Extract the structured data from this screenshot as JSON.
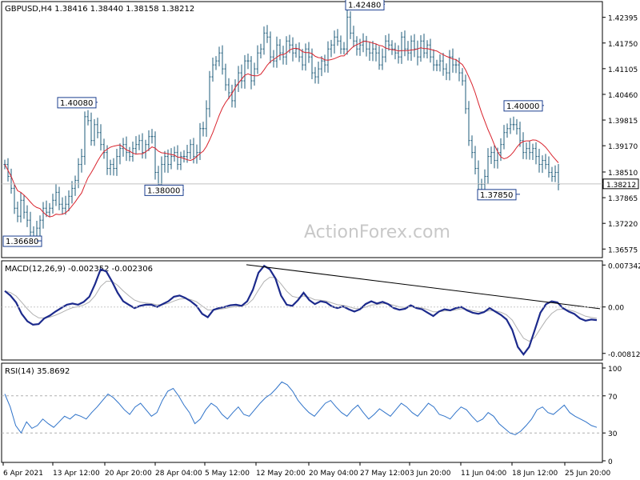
{
  "chart_data": [
    {
      "type": "candlestick",
      "panel": "price",
      "title": "GBPUSD,H4  1.38416 1.38440 1.38158 1.38212",
      "watermark": "ActionForex.com",
      "y_ticks": [
        "1.42395",
        "1.41750",
        "1.41105",
        "1.40460",
        "1.39815",
        "1.39170",
        "1.38510",
        "1.37865",
        "1.37220",
        "1.36575"
      ],
      "y_tick_values": [
        1.42395,
        1.4175,
        1.41105,
        1.4046,
        1.39815,
        1.3917,
        1.3851,
        1.37865,
        1.3722,
        1.36575
      ],
      "ylim": [
        1.364,
        1.4275
      ],
      "current_price_label": "1.38212",
      "current_price": 1.38212,
      "series": [
        {
          "name": "GBPUSD",
          "x": [
            0,
            4,
            8,
            12,
            16,
            20,
            24,
            28,
            32,
            36,
            40,
            44,
            48,
            52,
            56,
            60,
            64,
            68,
            72,
            76,
            80,
            84,
            88,
            92,
            96,
            100,
            104,
            108,
            112,
            116,
            120,
            124,
            128,
            132,
            136,
            140,
            144,
            148,
            152,
            156,
            160,
            164,
            168,
            172,
            176,
            180,
            184,
            188,
            192,
            196,
            200,
            204,
            208,
            212,
            216,
            220,
            224,
            228,
            232,
            236,
            240,
            244,
            248,
            252,
            256,
            260,
            264,
            268,
            272,
            276,
            280,
            284,
            288,
            292,
            296,
            300,
            304,
            308,
            312,
            316,
            320,
            324,
            328,
            332,
            336,
            340,
            344,
            348,
            352,
            356,
            360,
            364,
            368,
            372,
            376,
            380,
            384,
            388,
            392,
            396,
            400,
            404,
            408,
            412,
            416,
            420,
            424,
            428,
            432,
            436,
            440,
            444,
            448,
            452,
            456,
            460,
            464,
            468,
            472,
            476,
            480,
            484,
            488,
            492,
            496,
            500,
            504,
            508,
            512,
            516,
            520,
            524,
            528,
            532,
            536,
            540,
            544,
            548,
            552,
            556,
            560,
            564,
            568,
            572,
            576,
            580,
            584,
            588,
            592,
            596,
            600,
            604,
            608,
            612,
            616,
            620,
            624,
            628,
            632,
            636,
            640,
            644,
            648,
            652,
            656,
            660,
            664,
            668,
            672,
            676,
            680,
            684,
            688,
            692,
            696,
            700,
            704,
            708,
            712,
            716,
            720,
            724,
            728,
            732,
            736,
            740
          ],
          "close": [
            1.387,
            1.384,
            1.381,
            1.376,
            1.374,
            1.378,
            1.375,
            1.373,
            1.37,
            1.369,
            1.371,
            1.373,
            1.376,
            1.375,
            1.376,
            1.378,
            1.38,
            1.377,
            1.376,
            1.377,
            1.379,
            1.381,
            1.383,
            1.387,
            1.389,
            1.399,
            1.398,
            1.393,
            1.397,
            1.395,
            1.392,
            1.39,
            1.386,
            1.387,
            1.386,
            1.389,
            1.391,
            1.392,
            1.39,
            1.389,
            1.391,
            1.392,
            1.393,
            1.39,
            1.392,
            1.394,
            1.394,
            1.385,
            1.382,
            1.387,
            1.389,
            1.387,
            1.389,
            1.39,
            1.387,
            1.389,
            1.389,
            1.39,
            1.392,
            1.389,
            1.39,
            1.396,
            1.396,
            1.401,
            1.409,
            1.412,
            1.413,
            1.415,
            1.411,
            1.407,
            1.405,
            1.403,
            1.407,
            1.41,
            1.408,
            1.413,
            1.413,
            1.408,
            1.411,
            1.415,
            1.416,
            1.42,
            1.419,
            1.414,
            1.413,
            1.417,
            1.415,
            1.414,
            1.418,
            1.417,
            1.415,
            1.416,
            1.414,
            1.412,
            1.416,
            1.414,
            1.41,
            1.409,
            1.411,
            1.413,
            1.412,
            1.416,
            1.417,
            1.419,
            1.418,
            1.416,
            1.416,
            1.424,
            1.42,
            1.418,
            1.416,
            1.417,
            1.418,
            1.416,
            1.415,
            1.416,
            1.415,
            1.412,
            1.414,
            1.418,
            1.417,
            1.416,
            1.415,
            1.414,
            1.419,
            1.416,
            1.415,
            1.418,
            1.416,
            1.414,
            1.418,
            1.415,
            1.417,
            1.414,
            1.412,
            1.412,
            1.413,
            1.411,
            1.41,
            1.414,
            1.412,
            1.412,
            1.41,
            1.408,
            1.401,
            1.393,
            1.39,
            1.386,
            1.382,
            1.382,
            1.384,
            1.389,
            1.39,
            1.388,
            1.39,
            1.392,
            1.395,
            1.396,
            1.397,
            1.397,
            1.396,
            1.393,
            1.39,
            1.391,
            1.39,
            1.391,
            1.389,
            1.387,
            1.388,
            1.387,
            1.385,
            1.384,
            1.385,
            1.382
          ],
          "high_low_note": "highs/lows approx ±0.0015 around close"
        },
        {
          "name": "MA",
          "x": [
            0,
            740
          ],
          "note": "moving average line"
        }
      ],
      "annotations": [
        {
          "text": "1.42480",
          "value": 1.4248
        },
        {
          "text": "1.40080",
          "value": 1.4008
        },
        {
          "text": "1.38000",
          "value": 1.38
        },
        {
          "text": "1.36680",
          "value": 1.3668
        },
        {
          "text": "1.40000",
          "value": 1.4
        },
        {
          "text": "1.37850",
          "value": 1.3785
        }
      ]
    },
    {
      "type": "line",
      "panel": "macd",
      "title": "MACD(12,26,9) -0.002352 -0.002306",
      "y_ticks": [
        "0.007342",
        "0.00",
        "-0.008126"
      ],
      "y_tick_values": [
        0.007342,
        0.0,
        -0.008126
      ],
      "ylim": [
        -0.009,
        0.0078
      ],
      "series": [
        {
          "name": "MACD",
          "values": [
            0.0028,
            0.002,
            0.0008,
            -0.0012,
            -0.0025,
            -0.0031,
            -0.003,
            -0.002,
            -0.0015,
            -0.0008,
            -0.0002,
            0.0004,
            0.0006,
            0.0004,
            0.0009,
            0.0018,
            0.004,
            0.0066,
            0.0062,
            0.0045,
            0.0025,
            0.001,
            0.0004,
            -0.0002,
            0.0002,
            0.0004,
            0.0004,
            0.0,
            0.0005,
            0.001,
            0.0018,
            0.002,
            0.0016,
            0.001,
            0.0002,
            -0.0012,
            -0.0018,
            -0.0005,
            -0.0002,
            0.0,
            0.0003,
            0.0004,
            0.0002,
            0.001,
            0.003,
            0.006,
            0.0072,
            0.0066,
            0.005,
            0.002,
            0.0004,
            0.0002,
            0.0012,
            0.0025,
            0.0012,
            0.0005,
            0.001,
            0.0008,
            0.0001,
            -0.0002,
            0.0001,
            -0.0004,
            -0.0008,
            -0.0004,
            0.0005,
            0.001,
            0.0006,
            0.0009,
            0.0005,
            -0.0002,
            -0.0005,
            -0.0003,
            0.0003,
            -0.0002,
            -0.0004,
            -0.001,
            -0.0016,
            -0.0008,
            -0.0004,
            -0.0006,
            -0.0002,
            0.0,
            -0.0006,
            -0.001,
            -0.0012,
            -0.0009,
            -0.0002,
            -0.0008,
            -0.0014,
            -0.0022,
            -0.004,
            -0.007,
            -0.0083,
            -0.007,
            -0.004,
            -0.001,
            0.0005,
            0.001,
            0.0008,
            -0.0002,
            -0.0008,
            -0.0012,
            -0.002,
            -0.0024,
            -0.0022,
            -0.0023
          ]
        },
        {
          "name": "Signal",
          "note": "thin gray smoothing line"
        }
      ],
      "trendline": {
        "from": {
          "x": 308,
          "y": 0.0074
        },
        "to": {
          "x": 750,
          "y": -0.0003
        }
      }
    },
    {
      "type": "line",
      "panel": "rsi",
      "title": "RSI(14) 35.8692",
      "y_ticks": [
        "100",
        "70",
        "30",
        "0"
      ],
      "y_tick_values": [
        100,
        70,
        30,
        0
      ],
      "ylim": [
        0,
        100
      ],
      "levels": [
        70,
        30
      ],
      "series": [
        {
          "name": "RSI",
          "values": [
            72,
            58,
            38,
            30,
            42,
            35,
            38,
            45,
            40,
            36,
            42,
            48,
            45,
            50,
            48,
            45,
            52,
            58,
            65,
            72,
            68,
            62,
            55,
            50,
            58,
            62,
            55,
            48,
            52,
            65,
            75,
            78,
            70,
            60,
            52,
            40,
            45,
            55,
            62,
            58,
            50,
            45,
            52,
            58,
            50,
            48,
            55,
            62,
            68,
            72,
            78,
            85,
            82,
            75,
            65,
            58,
            52,
            48,
            55,
            62,
            65,
            58,
            52,
            48,
            55,
            60,
            52,
            45,
            50,
            56,
            52,
            48,
            55,
            62,
            58,
            52,
            48,
            55,
            62,
            58,
            50,
            48,
            45,
            52,
            58,
            55,
            48,
            42,
            45,
            52,
            48,
            40,
            35,
            30,
            28,
            32,
            38,
            45,
            55,
            58,
            52,
            50,
            55,
            60,
            52,
            48,
            45,
            42,
            38,
            36
          ]
        }
      ]
    }
  ],
  "x_axis": {
    "labels": [
      "6 Apr 2021",
      "13 Apr 12:00",
      "20 Apr 20:00",
      "28 Apr 04:00",
      "5 May 12:00",
      "12 May 20:00",
      "20 May 04:00",
      "27 May 12:00",
      "3 Jun 20:00",
      "11 Jun 04:00",
      "18 Jun 12:00",
      "25 Jun 20:00"
    ]
  },
  "colors": {
    "candles": "#1e5b7a",
    "ma": "#d9232d",
    "macd": "#1c2a8c",
    "signal": "#b0b0b0",
    "rsi": "#2f73c9",
    "trendline": "#000000",
    "grid_label_box": "#1c3f8f"
  }
}
